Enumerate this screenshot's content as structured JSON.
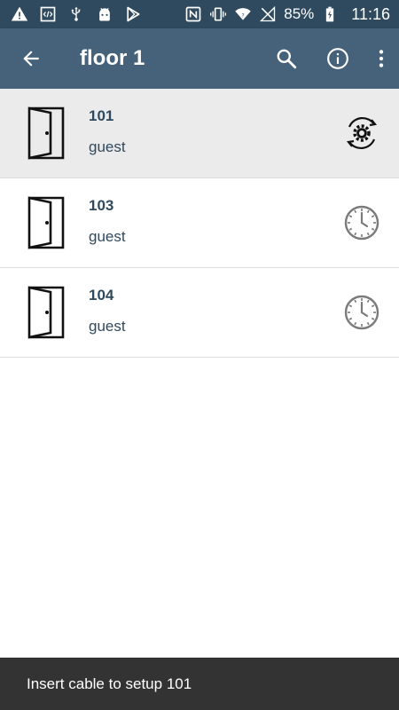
{
  "status_bar": {
    "left_icons": [
      "warning-icon",
      "code-icon",
      "usb-icon",
      "android-icon",
      "play-store-icon"
    ],
    "right_icons": [
      "nfc-icon",
      "vibrate-icon",
      "wifi-icon",
      "no-signal-icon",
      "battery-charging-icon"
    ],
    "battery": "85%",
    "time": "11:16"
  },
  "app_bar": {
    "title": "floor 1",
    "back_icon": "arrow-back-icon",
    "actions": [
      "search-icon",
      "info-icon",
      "more-vert-icon"
    ],
    "background": "#45627a"
  },
  "rooms": [
    {
      "number": "101",
      "type": "guest",
      "status_icon": "gear-sync-icon",
      "selected": true
    },
    {
      "number": "103",
      "type": "guest",
      "status_icon": "clock-icon",
      "selected": false
    },
    {
      "number": "104",
      "type": "guest",
      "status_icon": "clock-icon",
      "selected": false
    }
  ],
  "snackbar": {
    "message": "Insert cable to setup 101"
  },
  "colors": {
    "status_bar": "#2f4a5e",
    "app_bar": "#45627a",
    "selected_row": "#ebebeb",
    "text": "#2f4a5e",
    "snackbar": "#333333"
  }
}
